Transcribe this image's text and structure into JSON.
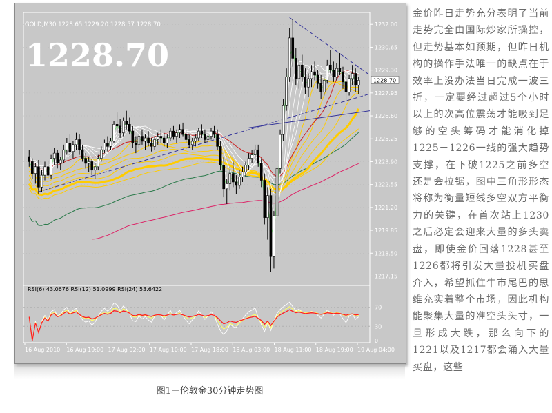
{
  "caption": "图1－伦敦金30分钟走势图",
  "article": "金价昨日走势充分表明了当前走势完全由国际炒家所操控，但走势基本如预期，但昨日机构的操作手法唯一的缺点在于效率上没办法当日完成一波三折，一定要经过超过5个小时以上的次高位震荡才能吸到足够的空头筹码才能消化掉1225－1226一线的强大趋势支撑，在下破1225之前多空还是会拉锯，图中三角形形态将称为衡量短线多空双方平衡力的关键，在首次站上1230之后必定会迎来大量的多头卖盘，即使金价回落1228甚至1226都将引发大量投机买盘介入，希望抓住牛市尾巴的思维充实着整个市场，因此机构能聚集大量的准空头头寸，一旦形成大跌，那么向下的1221以及1217都会涌入大量买盘，这些",
  "chart_data": {
    "type": "candlestick",
    "symbol_header": "GOLD,M30  1228.65 1229.20 1228.57 1228.70",
    "big_price": "1228.70",
    "price_tag": "1228.70",
    "ylim": [
      1216.6,
      1232.7
    ],
    "y_ticks": [
      "1232.00",
      "1230.65",
      "1229.30",
      "1227.95",
      "1226.60",
      "1225.25",
      "1223.90",
      "1222.55",
      "1221.20",
      "1219.85",
      "1218.50",
      "1217.15"
    ],
    "x_ticks": [
      "16 Aug 2010",
      "16 Aug 19:00",
      "17 Aug 02:00",
      "17 Aug 10:00",
      "17 Aug 18:00",
      "18 Aug 03:00",
      "18 Aug 11:00",
      "18 Aug 19:00",
      "19 Aug 04:00"
    ],
    "colors": {
      "background": "#c8c8c8",
      "up": "#ffffff",
      "down": "#000000",
      "rsi6": "#ffffff",
      "rsi12": "#ffff66",
      "rsi24": "#ff2020",
      "trend": "#333399",
      "ma_red": "#cc2222",
      "ma_green": "#2a7a4a",
      "ma_magenta": "#dd2266",
      "ma_gold": "#ffcc00"
    },
    "rsi": {
      "label": "RSI(6) 43.0676  RSI(12) 51.0999  RSI(24) 53.6422",
      "rsi6": 43.0676,
      "rsi12": 51.0999,
      "rsi24": 53.6422,
      "levels": [
        "70",
        "30",
        "0"
      ],
      "ylim": [
        0,
        100
      ]
    },
    "candles": [
      [
        1224.2,
        1224.6,
        1223.6,
        1223.9
      ],
      [
        1223.9,
        1224.1,
        1222.9,
        1223.2
      ],
      [
        1223.2,
        1223.8,
        1222.6,
        1223.6
      ],
      [
        1223.6,
        1224.0,
        1222.0,
        1222.4
      ],
      [
        1222.4,
        1223.4,
        1222.1,
        1223.1
      ],
      [
        1223.1,
        1223.9,
        1222.8,
        1223.6
      ],
      [
        1223.6,
        1223.9,
        1222.9,
        1223.1
      ],
      [
        1223.1,
        1224.3,
        1222.9,
        1224.1
      ],
      [
        1224.1,
        1224.7,
        1223.7,
        1224.4
      ],
      [
        1224.4,
        1224.6,
        1223.5,
        1223.8
      ],
      [
        1223.8,
        1224.2,
        1223.4,
        1224.0
      ],
      [
        1224.0,
        1224.9,
        1223.8,
        1224.6
      ],
      [
        1224.6,
        1225.3,
        1224.3,
        1225.0
      ],
      [
        1225.0,
        1225.5,
        1224.2,
        1224.5
      ],
      [
        1224.5,
        1225.1,
        1224.1,
        1224.9
      ],
      [
        1224.9,
        1225.6,
        1224.6,
        1225.2
      ],
      [
        1225.2,
        1225.5,
        1224.3,
        1224.6
      ],
      [
        1224.6,
        1224.9,
        1223.9,
        1224.1
      ],
      [
        1224.1,
        1224.4,
        1223.5,
        1223.8
      ],
      [
        1223.8,
        1224.2,
        1223.3,
        1223.9
      ],
      [
        1223.9,
        1224.1,
        1223.1,
        1223.4
      ],
      [
        1223.4,
        1223.8,
        1222.9,
        1223.6
      ],
      [
        1223.6,
        1224.3,
        1223.4,
        1224.1
      ],
      [
        1224.1,
        1224.8,
        1223.9,
        1224.6
      ],
      [
        1224.6,
        1225.2,
        1224.4,
        1225.0
      ],
      [
        1225.0,
        1225.4,
        1224.5,
        1224.8
      ],
      [
        1224.8,
        1225.3,
        1224.6,
        1225.1
      ],
      [
        1225.1,
        1226.3,
        1225.0,
        1226.1
      ],
      [
        1226.1,
        1226.8,
        1225.6,
        1226.0
      ],
      [
        1226.0,
        1226.4,
        1225.3,
        1225.6
      ],
      [
        1225.6,
        1226.5,
        1225.4,
        1226.3
      ],
      [
        1226.3,
        1226.9,
        1225.8,
        1226.1
      ],
      [
        1226.1,
        1226.5,
        1225.5,
        1225.7
      ],
      [
        1225.7,
        1226.0,
        1224.7,
        1225.0
      ],
      [
        1225.0,
        1225.4,
        1224.4,
        1224.9
      ],
      [
        1224.9,
        1225.6,
        1224.7,
        1225.4
      ],
      [
        1225.4,
        1225.8,
        1224.9,
        1225.1
      ],
      [
        1225.1,
        1225.5,
        1224.6,
        1225.3
      ],
      [
        1225.3,
        1225.7,
        1224.8,
        1225.0
      ],
      [
        1225.0,
        1225.3,
        1224.5,
        1224.8
      ],
      [
        1224.8,
        1225.4,
        1224.6,
        1225.2
      ],
      [
        1225.2,
        1225.6,
        1224.9,
        1225.4
      ],
      [
        1225.4,
        1225.8,
        1225.0,
        1225.3
      ],
      [
        1225.3,
        1225.6,
        1224.8,
        1225.0
      ],
      [
        1225.0,
        1225.5,
        1224.7,
        1225.3
      ],
      [
        1225.3,
        1225.9,
        1225.1,
        1225.7
      ],
      [
        1225.7,
        1226.0,
        1225.2,
        1225.4
      ],
      [
        1225.4,
        1225.8,
        1225.0,
        1225.6
      ],
      [
        1225.6,
        1226.1,
        1225.3,
        1225.8
      ],
      [
        1225.8,
        1226.2,
        1225.4,
        1225.5
      ],
      [
        1225.5,
        1225.8,
        1225.0,
        1225.2
      ],
      [
        1225.2,
        1225.5,
        1224.7,
        1224.9
      ],
      [
        1224.9,
        1225.3,
        1224.6,
        1225.1
      ],
      [
        1225.1,
        1225.5,
        1224.8,
        1225.3
      ],
      [
        1225.3,
        1225.9,
        1225.1,
        1225.7
      ],
      [
        1225.7,
        1226.1,
        1225.3,
        1225.5
      ],
      [
        1225.5,
        1225.8,
        1225.0,
        1225.2
      ],
      [
        1225.2,
        1225.6,
        1224.9,
        1225.4
      ],
      [
        1225.4,
        1225.9,
        1225.2,
        1225.7
      ],
      [
        1225.7,
        1226.0,
        1225.3,
        1225.5
      ],
      [
        1225.5,
        1225.8,
        1224.6,
        1224.8
      ],
      [
        1224.8,
        1225.1,
        1223.4,
        1223.7
      ],
      [
        1223.7,
        1224.2,
        1221.8,
        1222.3
      ],
      [
        1222.3,
        1222.9,
        1221.4,
        1222.6
      ],
      [
        1222.6,
        1223.6,
        1222.2,
        1223.2
      ],
      [
        1223.2,
        1223.9,
        1222.4,
        1222.7
      ],
      [
        1222.7,
        1223.1,
        1222.0,
        1222.5
      ],
      [
        1222.5,
        1223.4,
        1222.3,
        1223.0
      ],
      [
        1223.0,
        1223.6,
        1222.7,
        1223.3
      ],
      [
        1223.3,
        1223.9,
        1223.0,
        1223.7
      ],
      [
        1223.7,
        1224.4,
        1223.4,
        1224.1
      ],
      [
        1224.1,
        1224.6,
        1223.8,
        1224.3
      ],
      [
        1224.3,
        1224.9,
        1224.0,
        1224.6
      ],
      [
        1224.6,
        1224.9,
        1223.6,
        1223.8
      ],
      [
        1223.8,
        1224.1,
        1222.4,
        1222.8
      ],
      [
        1222.8,
        1223.2,
        1220.2,
        1220.6
      ],
      [
        1220.6,
        1222.4,
        1219.3,
        1221.9
      ],
      [
        1221.9,
        1222.3,
        1217.4,
        1218.3
      ],
      [
        1218.3,
        1221.0,
        1217.6,
        1220.7
      ],
      [
        1220.7,
        1223.8,
        1220.3,
        1223.5
      ],
      [
        1223.5,
        1225.8,
        1223.2,
        1225.5
      ],
      [
        1225.5,
        1227.6,
        1225.1,
        1227.2
      ],
      [
        1227.2,
        1229.4,
        1226.9,
        1228.9
      ],
      [
        1228.9,
        1231.8,
        1228.6,
        1231.2
      ],
      [
        1231.2,
        1232.3,
        1229.5,
        1230.0
      ],
      [
        1230.0,
        1230.6,
        1228.4,
        1228.8
      ],
      [
        1228.8,
        1229.9,
        1228.2,
        1229.6
      ],
      [
        1229.6,
        1230.2,
        1228.6,
        1228.9
      ],
      [
        1228.9,
        1229.4,
        1227.9,
        1228.3
      ],
      [
        1228.3,
        1229.1,
        1227.7,
        1228.8
      ],
      [
        1228.8,
        1229.6,
        1228.3,
        1229.2
      ],
      [
        1229.2,
        1229.8,
        1228.7,
        1229.0
      ],
      [
        1229.0,
        1229.3,
        1228.2,
        1228.5
      ],
      [
        1228.5,
        1229.0,
        1227.6,
        1228.0
      ],
      [
        1228.0,
        1228.9,
        1227.8,
        1228.7
      ],
      [
        1228.7,
        1229.9,
        1228.5,
        1229.6
      ],
      [
        1229.6,
        1230.5,
        1229.1,
        1229.3
      ],
      [
        1229.3,
        1229.8,
        1228.6,
        1228.9
      ],
      [
        1228.9,
        1229.7,
        1228.7,
        1229.4
      ],
      [
        1229.4,
        1230.3,
        1229.0,
        1229.2
      ],
      [
        1229.2,
        1229.5,
        1228.2,
        1228.6
      ],
      [
        1228.6,
        1229.1,
        1227.5,
        1228.0
      ],
      [
        1228.0,
        1229.0,
        1227.8,
        1228.8
      ],
      [
        1228.8,
        1229.6,
        1228.4,
        1229.1
      ],
      [
        1229.1,
        1229.4,
        1228.0,
        1228.4
      ],
      [
        1228.4,
        1228.9,
        1227.9,
        1228.7
      ]
    ]
  }
}
